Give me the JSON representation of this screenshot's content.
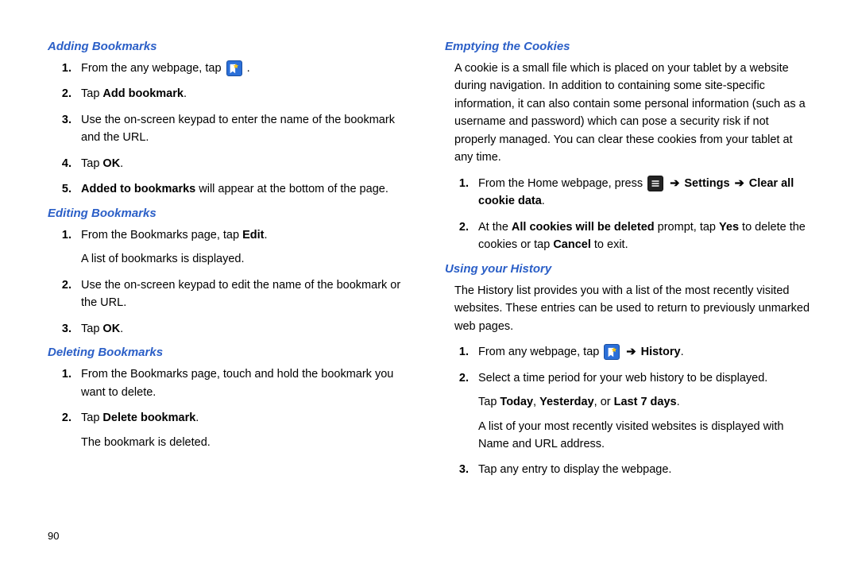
{
  "left": {
    "sec1": {
      "heading": "Adding Bookmarks",
      "steps": [
        {
          "pre": "From the any webpage, tap ",
          "post": "."
        },
        {
          "pre": "Tap ",
          "b1": "Add bookmark",
          "post": "."
        },
        {
          "text": "Use the on-screen keypad to enter the name of the bookmark and the URL."
        },
        {
          "pre": "Tap ",
          "b1": "OK",
          "post": "."
        },
        {
          "b1": "Added to bookmarks",
          "post": " will appear at the bottom of the page."
        }
      ]
    },
    "sec2": {
      "heading": "Editing Bookmarks",
      "steps": [
        {
          "pre": "From the Bookmarks page, tap ",
          "b1": "Edit",
          "post": ".",
          "after": "A list of bookmarks is displayed."
        },
        {
          "text": "Use the on-screen keypad to edit the name of the bookmark or the URL."
        },
        {
          "pre": "Tap ",
          "b1": "OK",
          "post": "."
        }
      ]
    },
    "sec3": {
      "heading": "Deleting Bookmarks",
      "steps": [
        {
          "text": "From the Bookmarks page, touch and hold the bookmark you want to delete."
        },
        {
          "pre": "Tap ",
          "b1": "Delete bookmark",
          "post": ".",
          "after": "The bookmark is deleted."
        }
      ]
    },
    "page_number": "90"
  },
  "right": {
    "sec1": {
      "heading": "Emptying the Cookies",
      "intro": "A cookie is a small file which is placed on your tablet by a website during navigation. In addition to containing some site-specific information, it can also contain some personal information (such as a username and password) which can pose a security risk if not properly managed. You can clear these cookies from your tablet at any time.",
      "steps": [
        {
          "pre": "From the Home webpage, press ",
          "arrow1": " ➔ ",
          "b1": "Settings",
          "arrow2": " ➔ ",
          "b2": "Clear all cookie data",
          "post": "."
        },
        {
          "pre": "At the ",
          "b1": "All cookies will be deleted",
          "mid": " prompt, tap ",
          "b2": "Yes",
          "mid2": " to delete the cookies or tap ",
          "b3": "Cancel",
          "post": " to exit."
        }
      ]
    },
    "sec2": {
      "heading": "Using your History",
      "intro": "The History list provides you with a list of the most recently visited websites. These entries can be used to return to previously unmarked web pages.",
      "steps": [
        {
          "pre": "From any webpage, tap ",
          "arrow1": " ➔ ",
          "b1": "History",
          "post": "."
        },
        {
          "text": "Select a time period for your web history to be displayed.",
          "after_pre": "Tap ",
          "after_b1": "Today",
          "after_mid": ", ",
          "after_b2": "Yesterday",
          "after_mid2": ", or ",
          "after_b3": "Last 7 days",
          "after_post": ".",
          "after2": "A list of your most recently visited websites is displayed with Name and URL address."
        },
        {
          "text": "Tap any entry to display the webpage."
        }
      ]
    }
  }
}
